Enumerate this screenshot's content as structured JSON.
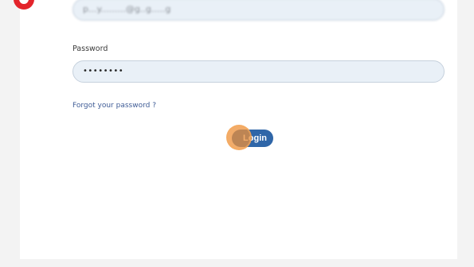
{
  "login_form": {
    "email_value": "p...y.........@g..g.....g",
    "password_label": "Password",
    "password_value": "••••••••",
    "forgot_link": "Forgot your password ?",
    "login_button": "Login"
  },
  "colors": {
    "accent": "#2f66a8",
    "click_marker": "#ee9038",
    "step_marker": "#e3242b"
  }
}
